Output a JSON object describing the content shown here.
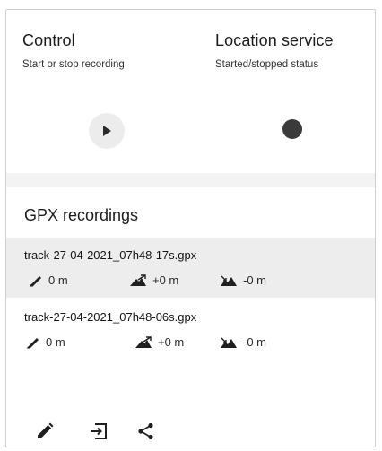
{
  "control": {
    "title": "Control",
    "subtitle": "Start or stop recording",
    "button_icon": "play-icon"
  },
  "location_service": {
    "title": "Location service",
    "subtitle": "Started/stopped status",
    "status_icon": "status-dot"
  },
  "gpx": {
    "title": "GPX recordings",
    "recordings": [
      {
        "name": "track-27-04-2021_07h48-17s.gpx",
        "distance": "0 m",
        "ascent": "+0 m",
        "descent": "-0 m",
        "selected": true
      },
      {
        "name": "track-27-04-2021_07h48-06s.gpx",
        "distance": "0 m",
        "ascent": "+0 m",
        "descent": "-0 m",
        "selected": false
      }
    ],
    "actions": [
      "edit-icon",
      "export-icon",
      "share-icon"
    ]
  },
  "colors": {
    "selected_row": "#ededed",
    "band": "#f3f3f3",
    "icon": "#1f1f1f",
    "play_bg": "#ececec"
  }
}
